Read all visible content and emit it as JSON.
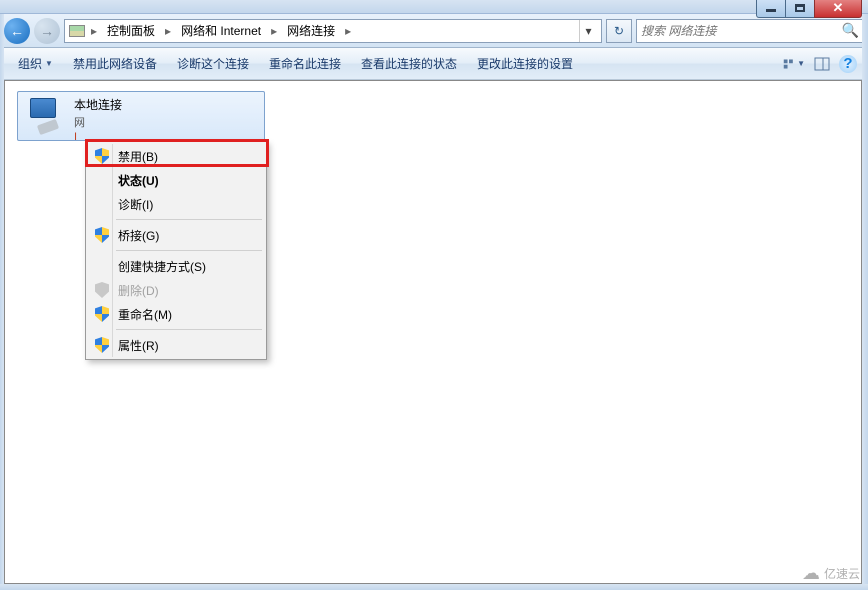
{
  "window": {
    "minimize": "–",
    "maximize": "□",
    "close": "✕"
  },
  "breadcrumb": {
    "sep": "▸",
    "items": [
      "控制面板",
      "网络和 Internet",
      "网络连接"
    ]
  },
  "search": {
    "placeholder": "搜索 网络连接",
    "icon": "🔍"
  },
  "toolbar": {
    "organize": "组织",
    "items": [
      "禁用此网络设备",
      "诊断这个连接",
      "重命名此连接",
      "查看此连接的状态",
      "更改此连接的设置"
    ]
  },
  "connection": {
    "name": "本地连接",
    "line2": "网",
    "line3": "I"
  },
  "context_menu": {
    "disable": "禁用(B)",
    "status": "状态(U)",
    "diagnose": "诊断(I)",
    "bridge": "桥接(G)",
    "shortcut": "创建快捷方式(S)",
    "delete": "删除(D)",
    "rename": "重命名(M)",
    "properties": "属性(R)"
  },
  "watermark": "亿速云"
}
